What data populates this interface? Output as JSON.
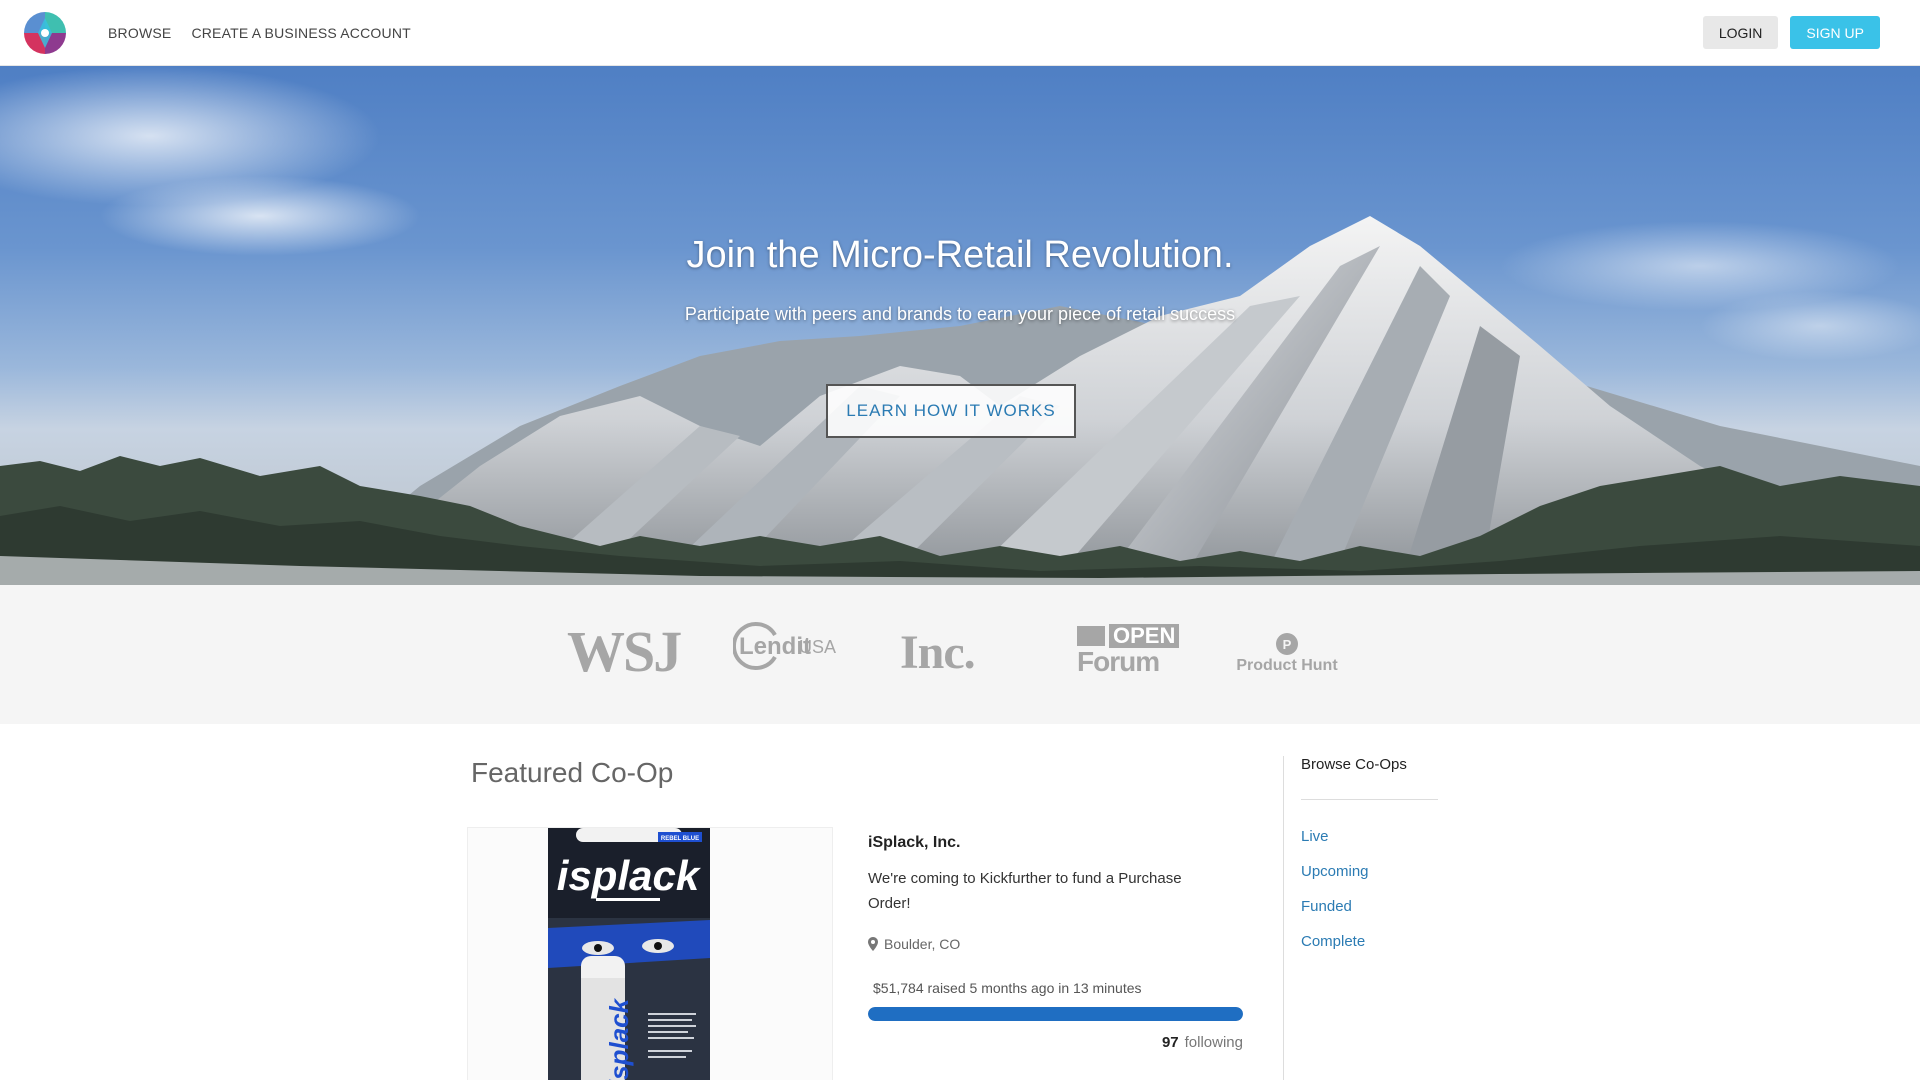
{
  "header": {
    "nav": [
      "BROWSE",
      "CREATE A BUSINESS ACCOUNT"
    ],
    "login": "LOGIN",
    "signup": "SIGN UP"
  },
  "hero": {
    "title": "Join the Micro-Retail Revolution.",
    "subtitle": "Participate with peers and brands to earn your piece of retail success",
    "cta": "LEARN HOW IT WORKS"
  },
  "press": {
    "wsj": "WSJ",
    "lendit": "Lendit",
    "lendit_suffix": "USA",
    "inc": "Inc.",
    "openforum_top": "OPEN",
    "openforum_bottom": "Forum",
    "producthunt_letter": "P",
    "producthunt": "Product Hunt"
  },
  "featured": {
    "section_title": "Featured Co-Op",
    "product_label_top": "REBEL BLUE",
    "product_brand": "isplack",
    "company": "iSplack, Inc.",
    "description": "We're coming to Kickfurther to fund a Purchase Order!",
    "location": "Boulder, CO",
    "raised": "$51,784 raised 5 months ago in 13 minutes",
    "progress_percent": 100,
    "following_count": "97",
    "following_label": "following"
  },
  "sidebar": {
    "title": "Browse Co-Ops",
    "links": [
      "Live",
      "Upcoming",
      "Funded",
      "Complete"
    ]
  },
  "colors": {
    "accent": "#3ac2e8",
    "link": "#2b7bb3",
    "progress": "#1f6ec2"
  }
}
